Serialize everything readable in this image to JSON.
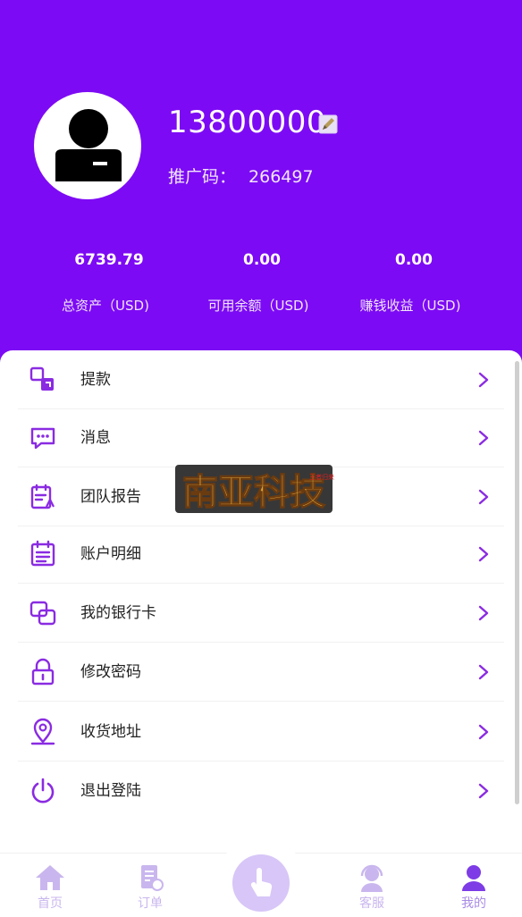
{
  "colors": {
    "brand": "#7d0af4",
    "icon": "#8a2be2",
    "tab_inactive": "#c9b6ee",
    "tab_active": "#a98be6"
  },
  "profile": {
    "avatar_icon": "user-silhouette-icon",
    "phone": "13800000",
    "edit_icon": "edit-icon",
    "referral_label": "推广码：",
    "referral_code": "266497"
  },
  "stats": [
    {
      "value": "6739.79",
      "label": "总资产（USD)"
    },
    {
      "value": "0.00",
      "label": "可用余额（USD)"
    },
    {
      "value": "0.00",
      "label": "赚钱收益（USD)"
    }
  ],
  "menu": [
    {
      "label": "提款",
      "icon": "withdraw-icon"
    },
    {
      "label": "消息",
      "icon": "message-icon"
    },
    {
      "label": "团队报告",
      "icon": "team-report-icon"
    },
    {
      "label": "账户明细",
      "icon": "account-details-icon"
    },
    {
      "label": "我的银行卡",
      "icon": "bank-card-icon"
    },
    {
      "label": "修改密码",
      "icon": "lock-icon"
    },
    {
      "label": "收货地址",
      "icon": "location-icon"
    },
    {
      "label": "退出登陆",
      "icon": "power-icon"
    }
  ],
  "watermark": {
    "text": "南亚科技",
    "small": "王者归来"
  },
  "tabs": [
    {
      "label": "首页",
      "icon": "home-icon"
    },
    {
      "label": "订单",
      "icon": "order-icon"
    },
    {
      "label": "",
      "icon": "tap-hand-icon"
    },
    {
      "label": "客服",
      "icon": "customer-service-icon"
    },
    {
      "label": "我的",
      "icon": "profile-icon",
      "active": true
    }
  ]
}
